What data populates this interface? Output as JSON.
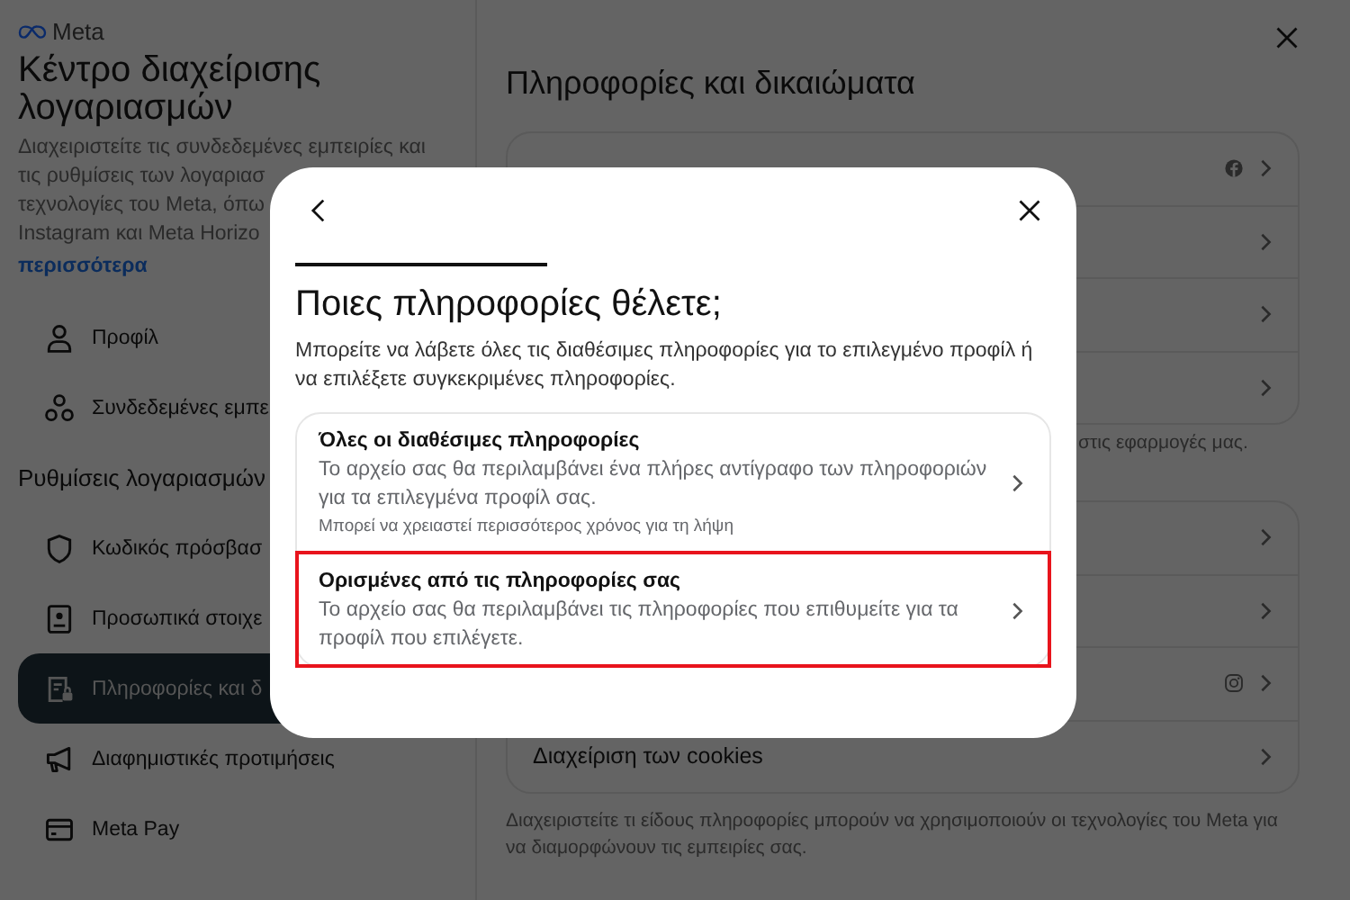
{
  "brand": {
    "name": "Meta"
  },
  "sidebar": {
    "title": "Κέντρο διαχείρισης λογαριασμών",
    "description_lines": [
      "Διαχειριστείτε τις συνδεδεμένες εμπειρίες και",
      "τις ρυθμίσεις των λογαριασ",
      "τεχνολογίες του Meta, όπω",
      "Instagram και Meta Horizo"
    ],
    "more_link": "περισσότερα",
    "items": [
      {
        "label": "Προφίλ",
        "selected": false
      },
      {
        "label": "Συνδεδεμένες εμπε",
        "selected": false
      }
    ],
    "section_title": "Ρυθμίσεις λογαριασμών",
    "section_items": [
      {
        "label": "Κωδικός πρόσβασ",
        "selected": false
      },
      {
        "label": "Προσωπικά στοιχε",
        "selected": false
      },
      {
        "label": "Πληροφορίες και δ",
        "selected": true
      },
      {
        "label": "Διαφημιστικές προτιμήσεις",
        "selected": false
      },
      {
        "label": "Meta Pay",
        "selected": false
      }
    ]
  },
  "main": {
    "title": "Πληροφορίες και δικαιώματα",
    "first_card": {
      "rows": [
        {},
        {},
        {},
        {}
      ]
    },
    "first_card_note": "στις εφαρμογές μας.",
    "second_card": {
      "rows": [
        {},
        {},
        {},
        {
          "label": "Διαχείριση των cookies"
        }
      ]
    },
    "second_card_note": "Διαχειριστείτε τι είδους πληροφορίες μπορούν να χρησιμοποιούν οι τεχνολογίες του Meta για να διαμορφώνουν τις εμπειρίες σας."
  },
  "dialog": {
    "title": "Ποιες πληροφορίες θέλετε;",
    "description": "Μπορείτε να λάβετε όλες τις διαθέσιμες πληροφορίες για το επιλεγμένο προφίλ ή να επιλέξετε συγκεκριμένες πληροφορίες.",
    "options": [
      {
        "title": "Όλες οι διαθέσιμες πληροφορίες",
        "description": "Το αρχείο σας θα περιλαμβάνει ένα πλήρες αντίγραφο των πληροφοριών για τα επιλεγμένα προφίλ σας.",
        "note": "Μπορεί να χρειαστεί περισσότερος χρόνος για τη λήψη",
        "highlighted": false
      },
      {
        "title": "Ορισμένες από τις πληροφορίες σας",
        "description": "Το αρχείο σας θα περιλαμβάνει τις πληροφορίες που επιθυμείτε για τα προφίλ που επιλέγετε.",
        "highlighted": true
      }
    ]
  }
}
